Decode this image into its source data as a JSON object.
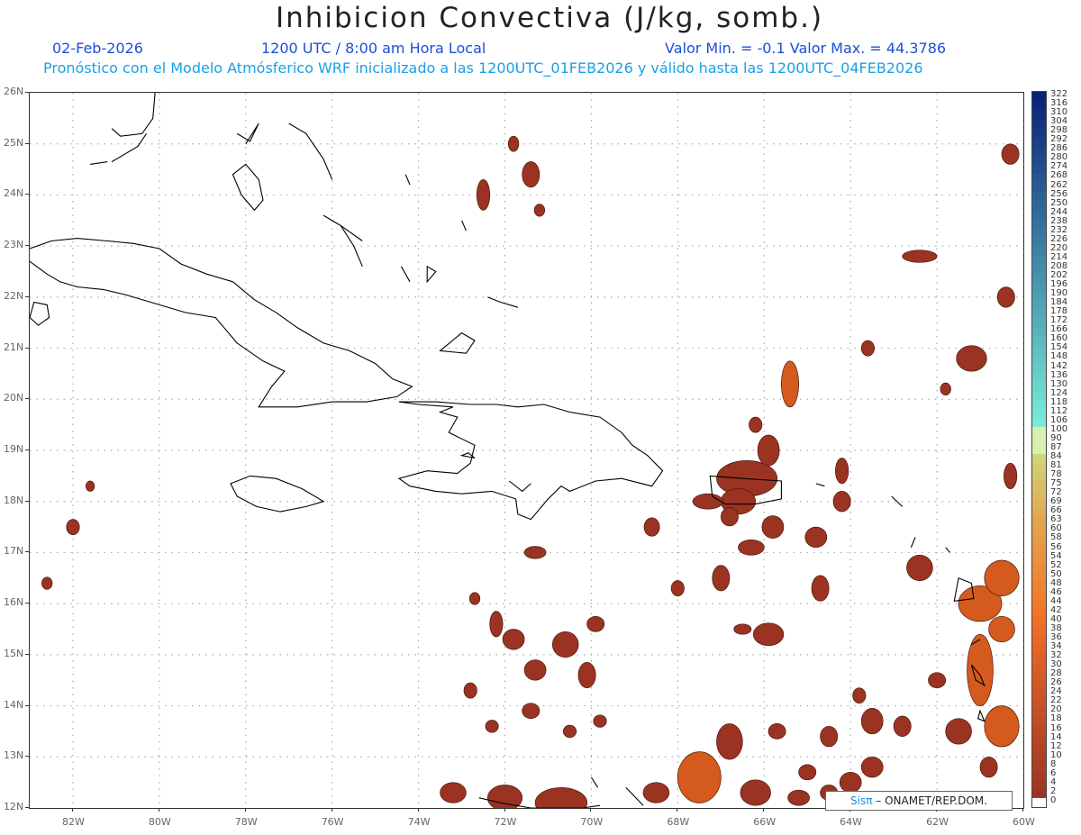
{
  "header": {
    "title": "Inhibicion Convectiva (J/kg, somb.)",
    "date": "02-Feb-2026",
    "time": "1200 UTC / 8:00 am Hora Local",
    "minmax": "Valor Min. = -0.1  Valor Max. = 44.3786",
    "forecast": "Pronóstico con el Modelo Atmósferico WRF inicializado a las 1200UTC_01FEB2026 y válido hasta las  1200UTC_04FEB2026"
  },
  "map": {
    "lon_range": [
      -83,
      -60
    ],
    "lat_range": [
      12,
      26
    ],
    "lat_labels": [
      "26N",
      "25N",
      "24N",
      "23N",
      "22N",
      "21N",
      "20N",
      "19N",
      "18N",
      "17N",
      "16N",
      "15N",
      "14N",
      "13N",
      "12N"
    ],
    "lon_labels": [
      "82W",
      "80W",
      "78W",
      "76W",
      "74W",
      "72W",
      "70W",
      "68W",
      "66W",
      "64W",
      "62W",
      "60W"
    ],
    "fill_color": "#9b3322",
    "fill_color_hot": "#d45a1e",
    "coast_color": "#000000"
  },
  "colorbar": {
    "labels": [
      "322",
      "316",
      "310",
      "304",
      "298",
      "292",
      "286",
      "280",
      "274",
      "268",
      "262",
      "256",
      "250",
      "244",
      "238",
      "232",
      "226",
      "220",
      "214",
      "208",
      "202",
      "196",
      "190",
      "184",
      "178",
      "172",
      "166",
      "160",
      "154",
      "148",
      "142",
      "136",
      "130",
      "124",
      "118",
      "112",
      "106",
      "100",
      "90",
      "87",
      "84",
      "81",
      "78",
      "75",
      "72",
      "69",
      "66",
      "63",
      "60",
      "58",
      "56",
      "54",
      "52",
      "50",
      "48",
      "46",
      "44",
      "42",
      "40",
      "38",
      "36",
      "34",
      "32",
      "30",
      "28",
      "26",
      "24",
      "22",
      "20",
      "18",
      "16",
      "14",
      "12",
      "10",
      "8",
      "6",
      "4",
      "2",
      "0"
    ]
  },
  "brand": {
    "sis": "Sis",
    "pi": "π",
    "rest": " – ONAMET/REP.DOM."
  }
}
